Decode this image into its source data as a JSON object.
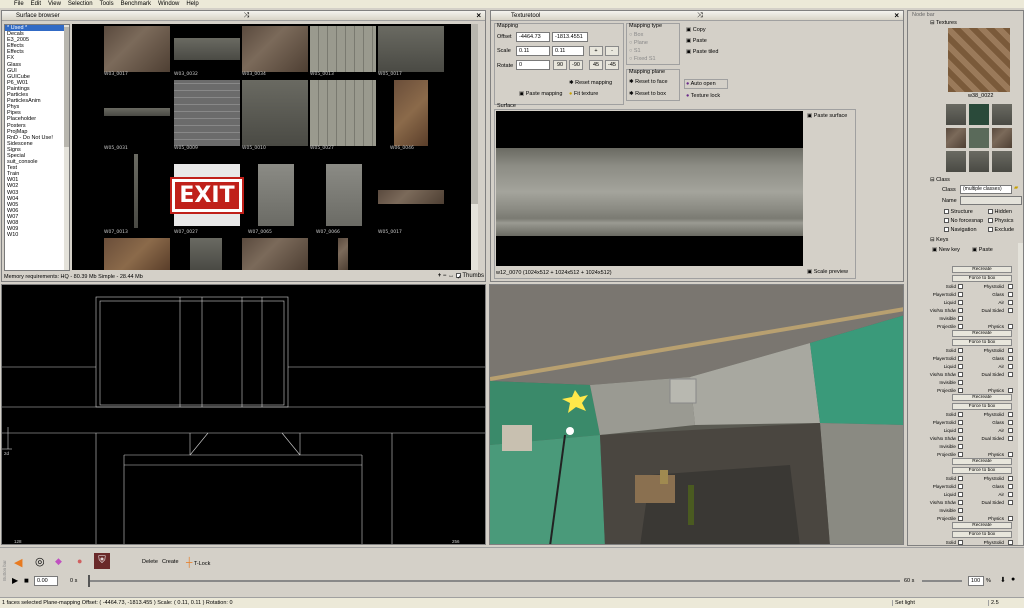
{
  "menu": [
    "File",
    "Edit",
    "View",
    "Selection",
    "Tools",
    "Benchmark",
    "Window",
    "Help"
  ],
  "surface_browser": {
    "title": "Surface browser",
    "categories": [
      "* Used *",
      "Decals",
      "E3_2005",
      "Effects",
      "Effects",
      "FX",
      "Glass",
      "GUI",
      "GUICube",
      "P6_W01",
      "Paintings",
      "Particles",
      "ParticlesAnim",
      "Phys",
      "Pipes",
      "Placeholder",
      "Posters",
      "ProjMap",
      "RnD - Do Not Use!",
      "Sidescene",
      "Signs",
      "Special",
      "suit_console",
      "Test",
      "Train",
      "W01",
      "W02",
      "W03",
      "W04",
      "W05",
      "W06",
      "W07",
      "W08",
      "W09",
      "W10"
    ],
    "thumb_labels": [
      "W03_0017",
      "W03_0032",
      "W03_0034",
      "W05_0013",
      "W05_0017",
      "W05_0031",
      "W05_0009",
      "W05_0010",
      "W05_0027",
      "W06_0046",
      "W07_0013",
      "W07_0027",
      "W07_0065",
      "W07_0066",
      "W05_0017"
    ],
    "exit_text": "EXIT",
    "memory": "Memory requirements: HQ - 80.39 Mb   Simple - 28.44 Mb",
    "thumbs_label": "Thumbs"
  },
  "texturetool": {
    "title": "Texturetool",
    "mapping": "Mapping",
    "offset_label": "Offset",
    "offset_x": "-4464.73",
    "offset_y": "-1813.4551",
    "scale_label": "Scale",
    "scale_x": "0.11",
    "scale_y": "0.11",
    "rotate_label": "Rotate",
    "rotate": "0",
    "rot_buttons": [
      "90",
      "-90",
      "45",
      "-45"
    ],
    "plus": "+",
    "minus": "-",
    "reset_mapping": "Reset mapping",
    "paste_mapping": "Paste mapping",
    "fit_texture": "Fit texture",
    "mapping_type": "Mapping type",
    "types": [
      "Box",
      "Plane",
      "S1",
      "Fixed S1"
    ],
    "mapping_plane": "Mapping plane",
    "reset_face": "Reset to face",
    "reset_box": "Reset to box",
    "copy": "Copy",
    "paste": "Paste",
    "paste_tiled": "Paste tiled",
    "auto_open": "Auto open",
    "texture_lock": "Texture lock",
    "surface": "Surface",
    "paste_surface": "Paste surface",
    "surface_info": "w12_0070 (1024x512 + 1024x512 + 1024x512)",
    "scale_preview": "Scale preview"
  },
  "nodebar": {
    "title": "Node bar",
    "textures": "Textures",
    "tex_name": "w38_0022",
    "class_section": "Class",
    "class_label": "Class",
    "class_value": "(multiple classes)",
    "name_label": "Name",
    "flags": [
      "Structure",
      "Hidden",
      "No forcesnap",
      "Physics",
      "Navigation",
      "Exclude"
    ],
    "keys": "Keys",
    "new_key": "New key",
    "paste_key": "Paste",
    "recreate": "Recreate",
    "force_box": "Force to box",
    "phys_rows": [
      [
        "Solid",
        "PhysSolid"
      ],
      [
        "PlayerSolid",
        "Glass"
      ],
      [
        "Liquid",
        "Air"
      ],
      [
        "Vis/No Shdw",
        "Dual Sided"
      ],
      [
        "Invisible",
        ""
      ],
      [
        "Projectile",
        "Physics"
      ]
    ]
  },
  "viewport2d": {
    "corner_tl": "2d",
    "corner_bl": "128",
    "corner_br": "256"
  },
  "timeline": {
    "delete": "Delete",
    "create": "Create",
    "tlock": "T-Lock",
    "time": "0.00",
    "unit": "0 s",
    "end": "60 s",
    "zoom": "100",
    "pct": "%",
    "side_label": "Button bar"
  },
  "status": {
    "text": "1 faces selected  Plane-mapping  Offset: ( -4464.73, -1813.455 )  Scale: ( 0.11, 0.11 )  Rotation: 0",
    "right1": "Set light",
    "right2": "2.5"
  }
}
